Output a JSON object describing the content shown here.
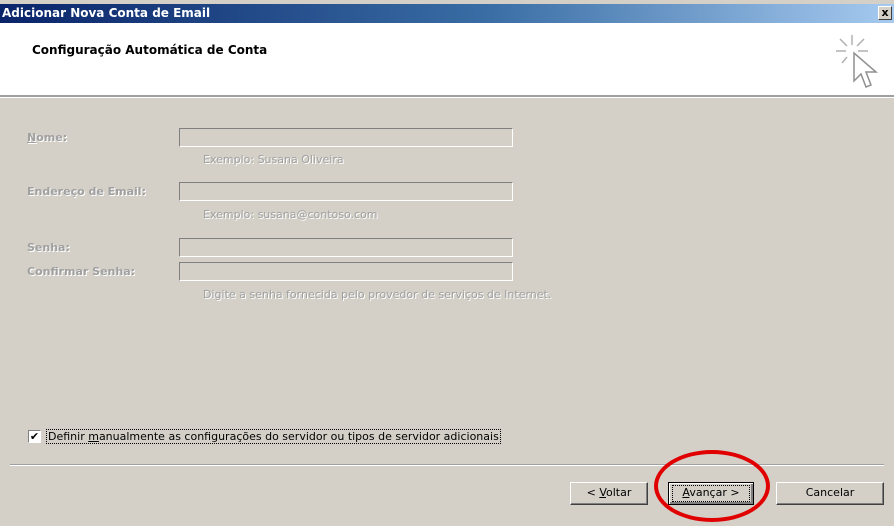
{
  "window": {
    "title": "Adicionar Nova Conta de Email",
    "close_label": "x"
  },
  "header": {
    "heading": "Configuração Automática de Conta"
  },
  "form": {
    "name_label": "Nome:",
    "name_value": "",
    "name_hint": "Exemplo: Susana Oliveira",
    "email_label": "Endereço de Email:",
    "email_value": "",
    "email_hint": "Exemplo: susana@contoso.com",
    "password_label": "Senha:",
    "password_value": "",
    "confirm_label": "Confirmar Senha:",
    "confirm_value": "",
    "password_hint": "Digite a senha fornecida pelo provedor de serviços de Internet."
  },
  "manual_config": {
    "checked": true,
    "label_before": "Definir ",
    "label_accel": "m",
    "label_after": "anualmente as configurações do servidor ou tipos de servidor adicionais"
  },
  "buttons": {
    "back_prefix": "< ",
    "back_accel": "V",
    "back_rest": "oltar",
    "next_accel": "A",
    "next_rest": "vançar >",
    "cancel": "Cancelar"
  },
  "colors": {
    "titlebar_start": "#0a246a",
    "titlebar_end": "#a6caf0",
    "dialog_face": "#d4d0c8",
    "annotation_circle": "#e00000"
  }
}
